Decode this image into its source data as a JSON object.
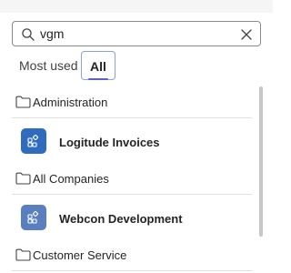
{
  "search": {
    "value": "vgm",
    "placeholder": ""
  },
  "tabs": [
    {
      "label": "Most used",
      "selected": false
    },
    {
      "label": "All",
      "selected": true
    }
  ],
  "items": [
    {
      "type": "folder",
      "label": "Administration",
      "icon": "folder-icon"
    },
    {
      "type": "app",
      "label": "Logitude Invoices",
      "icon": "app-grid-icon",
      "tile_color": "#2f6cbd"
    },
    {
      "type": "folder",
      "label": "All Companies",
      "icon": "folder-icon"
    },
    {
      "type": "app",
      "label": "Webcon Development",
      "icon": "app-grid-icon",
      "tile_color": "#5a7fbf"
    },
    {
      "type": "folder",
      "label": "Customer Service",
      "icon": "folder-icon"
    }
  ],
  "colors": {
    "accent": "#5b5fc7",
    "tab_focus_border": "#8aa0d8"
  }
}
